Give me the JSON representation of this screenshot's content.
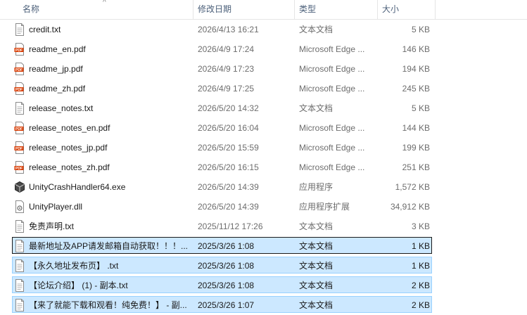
{
  "columns": {
    "name": "名称",
    "modified": "修改日期",
    "type": "类型",
    "size": "大小"
  },
  "sort_indicator": "^",
  "files": [
    {
      "name": "credit.txt",
      "modified": "2026/4/13 16:21",
      "type": "文本文档",
      "size": "5 KB",
      "icon": "txt",
      "selected": false
    },
    {
      "name": "readme_en.pdf",
      "modified": "2026/4/9 17:24",
      "type": "Microsoft Edge ...",
      "size": "146 KB",
      "icon": "pdf",
      "selected": false
    },
    {
      "name": "readme_jp.pdf",
      "modified": "2026/4/9 17:23",
      "type": "Microsoft Edge ...",
      "size": "194 KB",
      "icon": "pdf",
      "selected": false
    },
    {
      "name": "readme_zh.pdf",
      "modified": "2026/4/9 17:25",
      "type": "Microsoft Edge ...",
      "size": "245 KB",
      "icon": "pdf",
      "selected": false
    },
    {
      "name": "release_notes.txt",
      "modified": "2026/5/20 14:32",
      "type": "文本文档",
      "size": "5 KB",
      "icon": "txt",
      "selected": false
    },
    {
      "name": "release_notes_en.pdf",
      "modified": "2026/5/20 16:04",
      "type": "Microsoft Edge ...",
      "size": "144 KB",
      "icon": "pdf",
      "selected": false
    },
    {
      "name": "release_notes_jp.pdf",
      "modified": "2026/5/20 15:59",
      "type": "Microsoft Edge ...",
      "size": "199 KB",
      "icon": "pdf",
      "selected": false
    },
    {
      "name": "release_notes_zh.pdf",
      "modified": "2026/5/20 16:15",
      "type": "Microsoft Edge ...",
      "size": "251 KB",
      "icon": "pdf",
      "selected": false
    },
    {
      "name": "UnityCrashHandler64.exe",
      "modified": "2026/5/20 14:39",
      "type": "应用程序",
      "size": "1,572 KB",
      "icon": "exe",
      "selected": false
    },
    {
      "name": "UnityPlayer.dll",
      "modified": "2026/5/20 14:39",
      "type": "应用程序扩展",
      "size": "34,912 KB",
      "icon": "dll",
      "selected": false
    },
    {
      "name": "免责声明.txt",
      "modified": "2025/11/12 17:26",
      "type": "文本文档",
      "size": "3 KB",
      "icon": "txt",
      "selected": false
    },
    {
      "name": "最新地址及APP请发邮箱自动获取！！！...",
      "modified": "2025/3/26 1:08",
      "type": "文本文档",
      "size": "1 KB",
      "icon": "txt",
      "selected": true,
      "focus": true
    },
    {
      "name": "【永久地址发布页】 .txt",
      "modified": "2025/3/26 1:08",
      "type": "文本文档",
      "size": "1 KB",
      "icon": "txt",
      "selected": true
    },
    {
      "name": "【论坛介绍】 (1) - 副本.txt",
      "modified": "2025/3/26 1:08",
      "type": "文本文档",
      "size": "2 KB",
      "icon": "txt",
      "selected": true
    },
    {
      "name": "【来了就能下载和观看！纯免费！】 - 副...",
      "modified": "2025/3/26 1:07",
      "type": "文本文档",
      "size": "2 KB",
      "icon": "txt",
      "selected": true
    }
  ]
}
